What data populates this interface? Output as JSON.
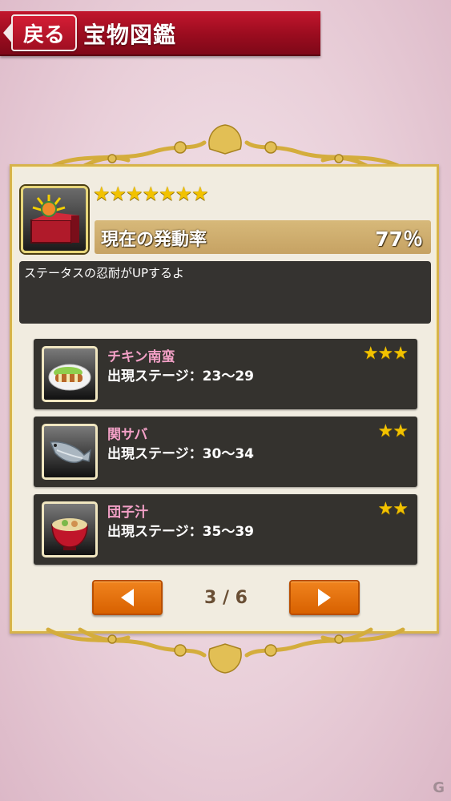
{
  "header": {
    "back_label": "戻る",
    "title": "宝物図鑑"
  },
  "treasure": {
    "rarity_stars": "★★★★★★★",
    "rate_label": "現在の発動率",
    "rate_value": "77％",
    "description": "ステータスの忍耐がUPするよ"
  },
  "foods": [
    {
      "name": "チキン南蛮",
      "stage": "出現ステージ：23〜29",
      "stars": "★★★"
    },
    {
      "name": "関サバ",
      "stage": "出現ステージ：30〜34",
      "stars": "★★"
    },
    {
      "name": "団子汁",
      "stage": "出現ステージ：35〜39",
      "stars": "★★"
    }
  ],
  "pager": {
    "indicator": "3 / 6"
  },
  "watermark": "G",
  "colors": {
    "header_red": "#a10f22",
    "panel_gold": "#d7b34a",
    "button_orange": "#e8731a",
    "food_name_pink": "#f2a0c6",
    "star_gold": "#f2c200"
  }
}
